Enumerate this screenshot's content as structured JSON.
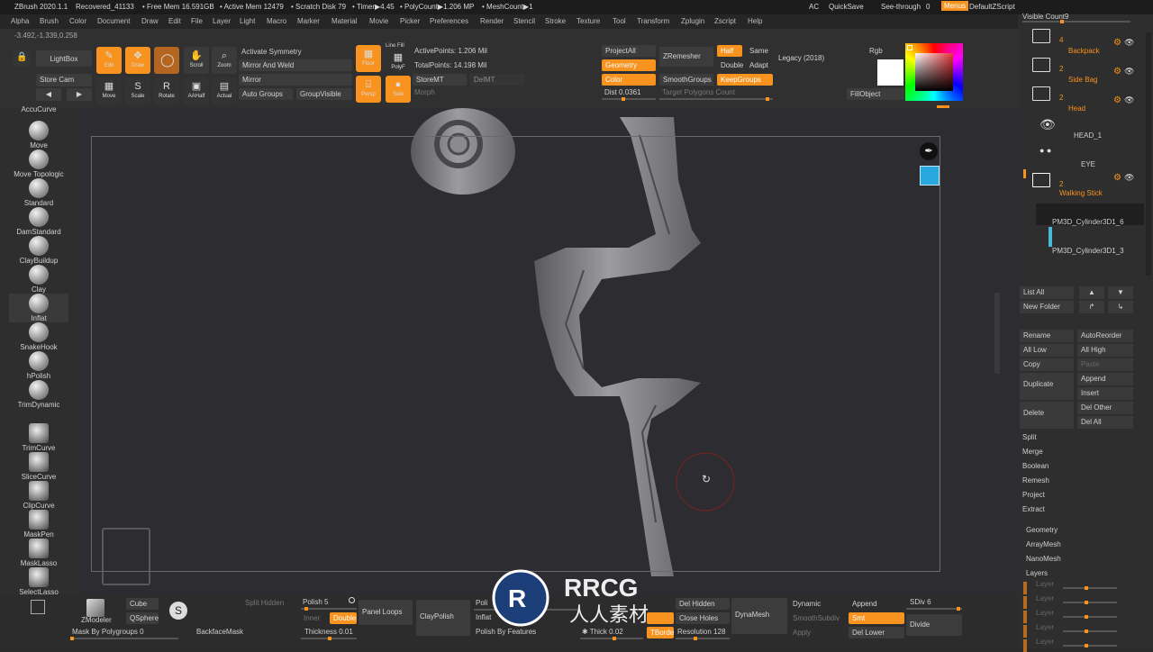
{
  "titlebar": {
    "app": "ZBrush 2020.1.1",
    "file": "Recovered_41133",
    "free_mem": "• Free Mem 16.591GB",
    "active_mem": "• Active Mem 12479",
    "scratch": "• Scratch Disk 79",
    "timer": "• Timer▶4.45",
    "polycount": "• PolyCount▶1.206 MP",
    "meshcount": "• MeshCount▶1",
    "ac": "AC",
    "quicksave": "QuickSave",
    "seethrough": "See-through",
    "seethrough_value": "0",
    "menus": "Menus",
    "zscript": "DefaultZScript"
  },
  "menubar": [
    "Alpha",
    "Brush",
    "Color",
    "Document",
    "Draw",
    "Edit",
    "File",
    "Layer",
    "Light",
    "Macro",
    "Marker",
    "Material",
    "Movie",
    "Picker",
    "Preferences",
    "Render",
    "Stencil",
    "Stroke",
    "Texture",
    "Tool",
    "Transform",
    "Zplugin",
    "Zscript",
    "Help"
  ],
  "coords": "-3.492,-1.339,0.258",
  "toolbar": {
    "lightbox": "LightBox",
    "storecam": "Store Cam",
    "edit": "Edit",
    "draw": "Draw",
    "scroll": "Scroll",
    "zoom": "Zoom",
    "move": "Move",
    "scale": "Scale",
    "rotate": "Rotate",
    "aahalf": "AAHalf",
    "actual": "Actual",
    "activate_symmetry": "Activate Symmetry",
    "mirror_weld": "Mirror And Weld",
    "mirror": "Mirror",
    "auto_groups": "Auto Groups",
    "group_visible": "GroupVisible",
    "floor": "Floor",
    "linefill": "Line Fill",
    "polyf": "PolyF",
    "persp": "Persp",
    "solo": "Solo",
    "active_points": "ActivePoints: 1.206 Mil",
    "total_points": "TotalPoints: 14.198 Mil",
    "storemt": "StoreMT",
    "delmt": "DelMT",
    "morph": "Morph",
    "projectall": "ProjectAll",
    "geometry": "Geometry",
    "color": "Color",
    "dist_label": "Dist",
    "dist_value": "0.0361",
    "zremesher": "ZRemesher",
    "smoothgroups": "SmoothGroups",
    "target_poly": "Target Polygons Count",
    "half": "Half",
    "same": "Same",
    "double": "Double",
    "adapt": "Adapt",
    "keepgroups": "KeepGroups",
    "legacy": "Legacy (2018)",
    "rgb": "Rgb",
    "fillobject": "FillObject"
  },
  "brushes": [
    "AccuCurve",
    "Move",
    "Move Topologic",
    "Standard",
    "DamStandard",
    "ClayBuildup",
    "Clay",
    "Inflat",
    "SnakeHook",
    "hPolish",
    "TrimDynamic",
    "TrimCurve",
    "SliceCurve",
    "ClipCurve",
    "MaskPen",
    "MaskLasso",
    "SelectLasso",
    "SelectRect"
  ],
  "rightpanel": {
    "visible_count": "Visible Count",
    "visible_count_value": "9",
    "folders": [
      {
        "count": "4",
        "name": "Backpack"
      },
      {
        "count": "2",
        "name": "Side Bag"
      },
      {
        "count": "2",
        "name": "Head"
      }
    ],
    "head_item": "HEAD_1",
    "eye_item": "EYE",
    "walking_count": "2",
    "walking_name": "Walking Stick",
    "pm1": "PM3D_Cylinder3D1_6",
    "pm2": "PM3D_Cylinder3D1_3",
    "list_all": "List All",
    "new_folder": "New Folder",
    "rename": "Rename",
    "autoreorder": "AutoReorder",
    "all_low": "All Low",
    "all_high": "All High",
    "copy": "Copy",
    "paste": "Paste",
    "duplicate": "Duplicate",
    "append": "Append",
    "insert": "Insert",
    "delete": "Delete",
    "del_other": "Del Other",
    "del_all": "Del All",
    "split": "Split",
    "merge": "Merge",
    "boolean": "Boolean",
    "remesh": "Remesh",
    "project": "Project",
    "extract": "Extract",
    "geometry": "Geometry",
    "arraymesh": "ArrayMesh",
    "nanomesh": "NanoMesh",
    "layers": "Layers",
    "layer": "Layer"
  },
  "bottom": {
    "zmodeler": "ZModeler",
    "cube": "Cube",
    "qsphere": "QSphere",
    "mask_by_polygroups": "Mask By Polygroups",
    "mask_by_polygroups_value": "0",
    "backface_mask": "BackfaceMask",
    "split_hidden": "Split Hidden",
    "polish": "Polish",
    "polish_value": "5",
    "inner": "Inner",
    "double": "Double",
    "thickness": "Thickness",
    "thickness_value": "0.01",
    "panel_loops": "Panel Loops",
    "claypolish": "ClayPolish",
    "poli": "Poli",
    "inflat": "Inflat",
    "polish_by_features": "Polish By Features",
    "thick": "Thick",
    "thick_value": "0.02",
    "del_hidden": "Del Hidden",
    "close_holes": "Close Holes",
    "resolution": "Resolution",
    "resolution_value": "128",
    "tborde": "TBorde",
    "dynamesh": "DynaMesh",
    "dynamic": "Dynamic",
    "smoothsubdiv": "SmoothSubdiv",
    "apply": "Apply",
    "append": "Append",
    "smt": "Smt",
    "del_lower": "Del Lower",
    "sdiv": "SDiv",
    "sdiv_value": "6",
    "divide": "Divide"
  },
  "watermark": {
    "latin": "RRCG",
    "cjk": "人人素材"
  },
  "colors": {
    "accent": "#f7931e",
    "background": "#2d2c30"
  }
}
